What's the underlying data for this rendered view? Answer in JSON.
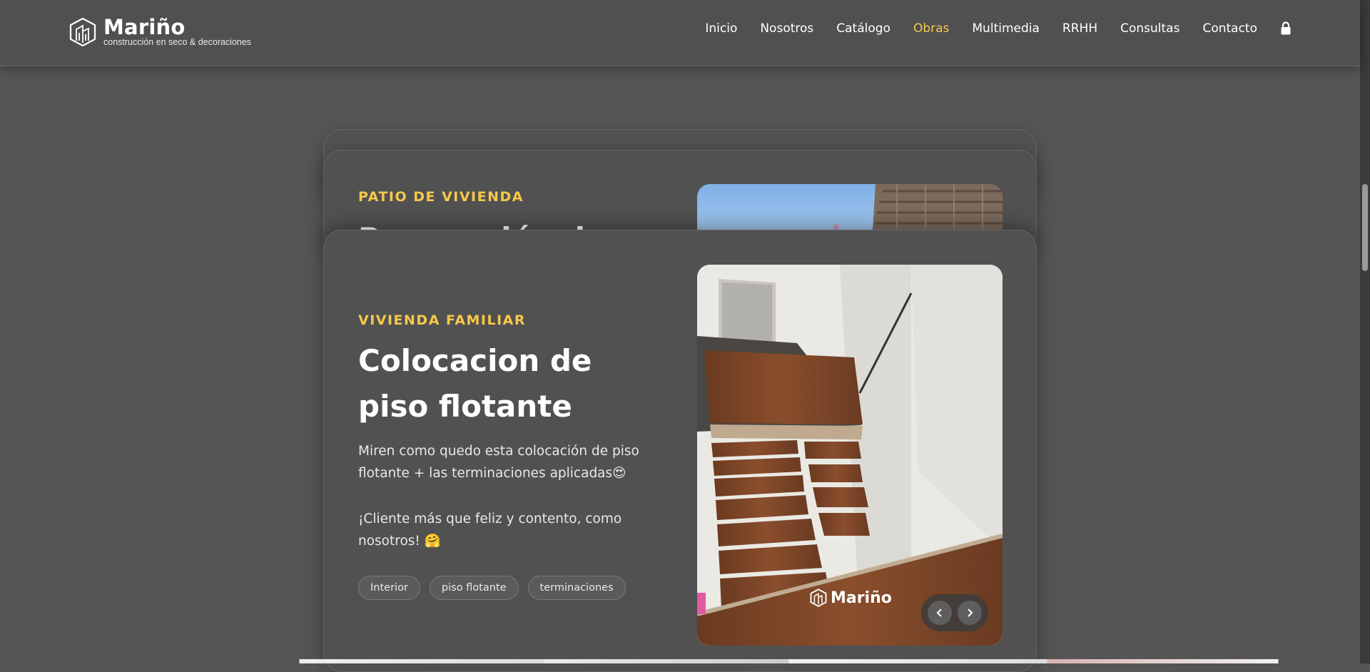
{
  "brand": {
    "name": "Mariño",
    "tagline": "construcción en seco & decoraciones"
  },
  "nav": {
    "items": [
      {
        "label": "Inicio",
        "active": false
      },
      {
        "label": "Nosotros",
        "active": false
      },
      {
        "label": "Catálogo",
        "active": false
      },
      {
        "label": "Obras",
        "active": true
      },
      {
        "label": "Multimedia",
        "active": false
      },
      {
        "label": "RRHH",
        "active": false
      },
      {
        "label": "Consultas",
        "active": false
      },
      {
        "label": "Contacto",
        "active": false
      }
    ],
    "lock_icon": "lock-icon"
  },
  "cards": {
    "back": {
      "eyebrow": "PATIO DE VIVIENDA",
      "title_partial": "Renovación de"
    },
    "front": {
      "eyebrow": "VIVIENDA FAMILIAR",
      "title": "Colocacion de piso flotante",
      "paragraphs": [
        "Miren como quedo esta colocación de piso flotante + las terminaciones aplicadas😍",
        "¡Cliente más que feliz y contento, como nosotros! 🤗"
      ],
      "tags": [
        "Interior",
        "piso flotante",
        "terminaciones"
      ],
      "photo_watermark": "Mariño"
    }
  },
  "colors": {
    "accent": "#f5c84b",
    "background": "#555555",
    "card": "#515151"
  }
}
